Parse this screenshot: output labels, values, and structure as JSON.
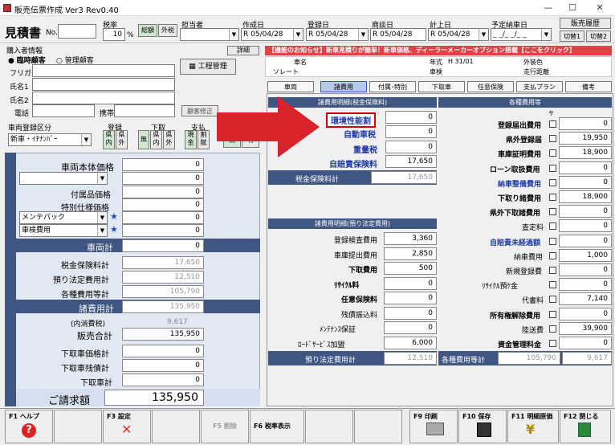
{
  "window": {
    "title": "販売伝票作成 Ver3 Rev0.40"
  },
  "header": {
    "doc_title": "見積書",
    "no_label": "No.",
    "no_value": "",
    "tax_label": "税率",
    "tax_value": "10",
    "tax_unit": "%",
    "tax_in": "総額",
    "tax_out": "外税",
    "staff_label": "担当者",
    "created_label": "作成日",
    "created": "R 05/04/28",
    "registered_label": "登録日",
    "registered": "R 05/04/28",
    "negotiated_label": "商談日",
    "negotiated": "R 05/04/28",
    "booked_label": "計上日",
    "booked": "R 05/04/28",
    "planned_label": "予定納車日",
    "planned": "_ _/_ _/_ _",
    "history_btn": "販売履歴",
    "switch1": "切替1",
    "switch2": "切替2"
  },
  "buyer": {
    "section": "購入者情報",
    "detail_btn": "詳細",
    "opt_temp": "臨時顧客",
    "opt_managed": "管理顧客",
    "furigana": "フリガナ",
    "name1": "氏名1",
    "name2": "氏名2",
    "phone": "電話",
    "mobile": "携帯",
    "process_btn": "工程管理",
    "customer_fix_btn": "顧客修正",
    "reg_area_label": "車両登録区分",
    "reg_area_value": "新車・ｲﾁﾅﾝﾊﾞｰ",
    "reg_label": "登録",
    "reg_in": "県内",
    "reg_out": "県外",
    "trade_label": "下取",
    "trade_none": "無",
    "trade_in": "県内",
    "trade_out": "県外",
    "pay_label": "支払",
    "pay_cash": "現金",
    "pay_loan": "割賦",
    "none": "無",
    "yes": "有"
  },
  "left": {
    "base_price_label": "車両本体価格",
    "base_price": "0",
    "combo1": "",
    "combo1_val": "0",
    "accessory_label": "付属品価格",
    "accessory": "0",
    "special_label": "特別仕様価格",
    "special": "0",
    "combo2": "メンテパック",
    "combo2_val": "0",
    "combo3": "車検費用",
    "combo3_val": "0",
    "car_total_label": "車両計",
    "car_total": "0",
    "tax_ins_label": "税金保険料計",
    "tax_ins": "17,650",
    "legal_label": "預り法定費用計",
    "legal": "12,510",
    "misc_label": "各種費用等計",
    "misc": "105,790",
    "fees_label": "諸費用計",
    "fees": "135,950",
    "incl_tax_label": "(内消費税)",
    "incl_tax": "9,617",
    "sales_label": "販売合計",
    "sales": "135,950",
    "trade_price_label": "下取車価格計",
    "trade_price": "0",
    "trade_rest_label": "下取車残債計",
    "trade_rest": "0",
    "trade_total_label": "下取車計",
    "trade_total": "0",
    "invoice_label": "ご請求額",
    "invoice": "135,950"
  },
  "notice": "【機能のお知らせ】新車見積りが簡単！新車価格、ディーラーメーカーオプション搭載【ここをクリック】",
  "carinfo": {
    "maker": "車名",
    "model": "ソレート",
    "year_label": "年式",
    "year": "H 31/01",
    "color_label": "外装色",
    "grade": "車検",
    "distance": "走行距離"
  },
  "tabs": [
    "車両",
    "諸費用",
    "付属･特別",
    "下取車",
    "任意保険",
    "支払プラン",
    "備考"
  ],
  "taxes": {
    "header": "諸費用明細(税金保険料)",
    "r1": "環境性能割",
    "v1": "0",
    "r2": "自動車税",
    "v2": "0",
    "r3": "重量税",
    "v3": "0",
    "r4": "自賠責保険料",
    "v4": "17,650",
    "total_label": "税金保険料計",
    "total": "17,650"
  },
  "legal": {
    "header": "諸費用明細(預り法定費用)",
    "rows": [
      [
        "登録検査費用",
        "3,360"
      ],
      [
        "車庫提出費用",
        "2,850"
      ],
      [
        "下取費用",
        "500"
      ],
      [
        "ﾘｻｲｸﾙ料",
        "0"
      ],
      [
        "任意保険料",
        "0"
      ],
      [
        "残債振込料",
        "0"
      ],
      [
        "ﾒﾝﾃﾅﾝｽ保証",
        "0"
      ],
      [
        "ﾛｰﾄﾞｻｰﾋﾞｽ加盟",
        "6,000"
      ]
    ],
    "total_label": "預り法定費用計",
    "total": "12,510"
  },
  "misc": {
    "header": "各種費用等",
    "sa": "サ",
    "rows": [
      [
        "登録届出費用",
        "0"
      ],
      [
        "県外登録届",
        "19,950"
      ],
      [
        "車庫証明費用",
        "18,900"
      ],
      [
        "ローン取扱費用",
        "0"
      ],
      [
        "納車整備費用",
        "0"
      ],
      [
        "下取り諸費用",
        "18,900"
      ],
      [
        "県外下取諸費用",
        "0"
      ],
      [
        "査定料",
        "0"
      ],
      [
        "自賠責未経過額",
        "0"
      ],
      [
        "納車費用",
        "1,000"
      ],
      [
        "新規登録費",
        "0"
      ],
      [
        "ﾘｻｲｸﾙ預ｹ金",
        "0"
      ],
      [
        "代書料",
        "7,140"
      ],
      [
        "所有権解除費用",
        "0"
      ],
      [
        "陸送費",
        "39,900"
      ],
      [
        "資金管理料金",
        "0"
      ]
    ],
    "total_label": "各種費用等計",
    "total": "105,790",
    "tax": "9,617"
  },
  "fkeys": {
    "f1": "F1 ヘルプ",
    "f3": "F3 設定",
    "f5": "F5 削除",
    "f6": "F6 税率表示",
    "f9": "F9 印刷",
    "f10": "F10 保存",
    "f11": "F11 明細原価",
    "f12": "F12 閉じる"
  }
}
